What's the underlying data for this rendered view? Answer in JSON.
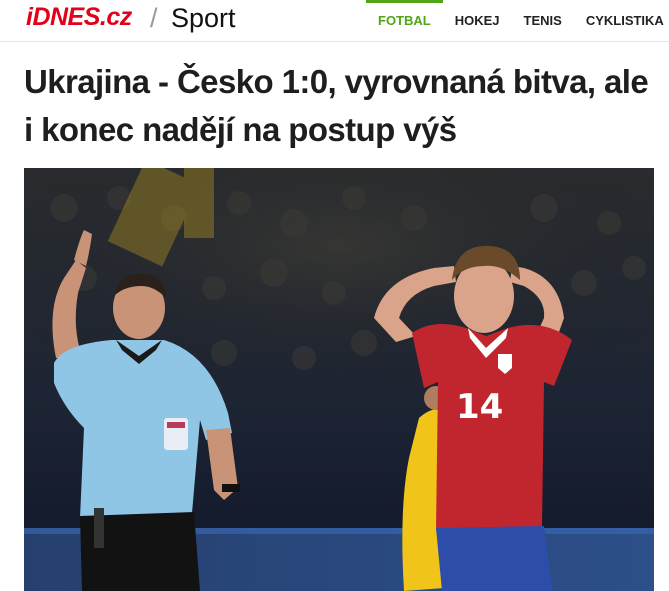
{
  "header": {
    "logo_text": "iDNES.cz",
    "separator": "/",
    "section_title": "Sport",
    "nav": [
      {
        "label": "FOTBAL",
        "active": true
      },
      {
        "label": "HOKEJ",
        "active": false
      },
      {
        "label": "TENIS",
        "active": false
      },
      {
        "label": "CYKLISTIKA",
        "active": false
      }
    ],
    "colors": {
      "brand": "#e2001a",
      "accent": "#51a516"
    }
  },
  "article": {
    "headline": "Ukrajina - Česko 1:0, vyrovnaná bitva, ale i konec nadějí na postup výš",
    "photo": {
      "jersey_number": "14"
    }
  }
}
